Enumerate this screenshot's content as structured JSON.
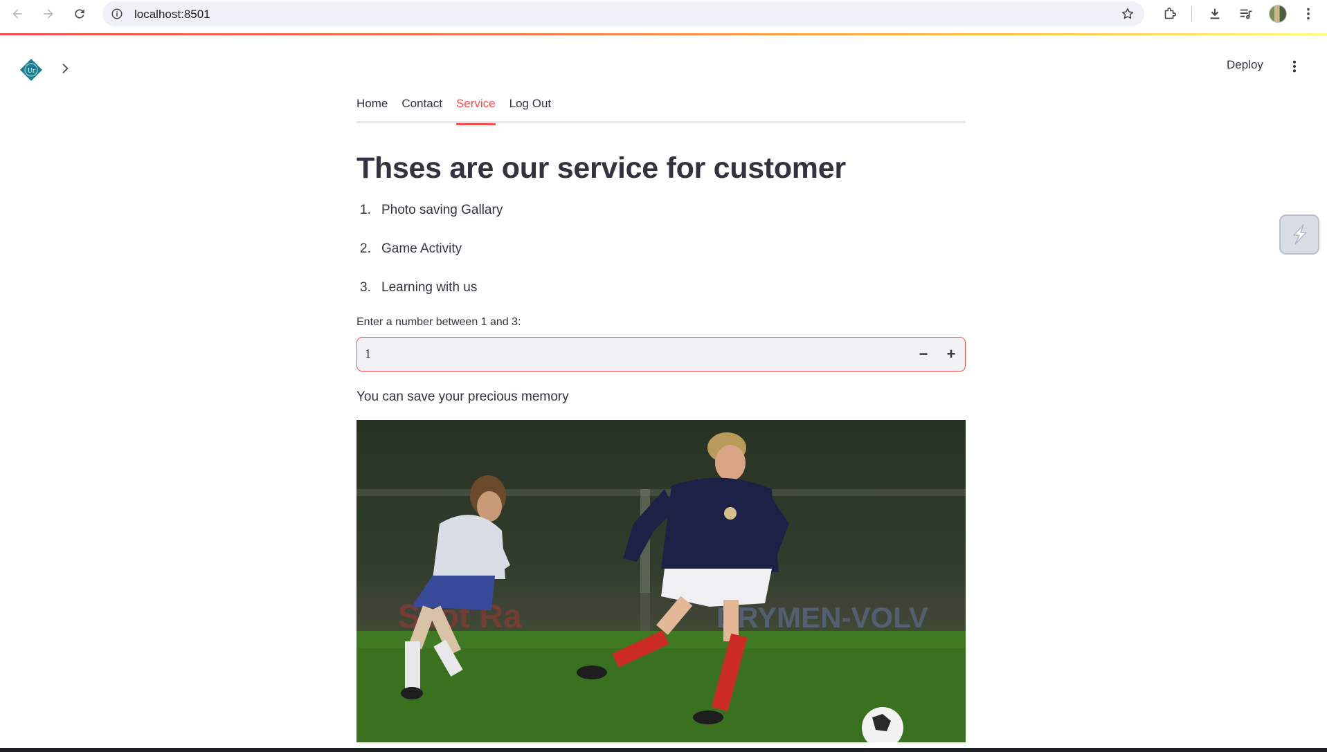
{
  "browser": {
    "url": "localhost:8501"
  },
  "header": {
    "deploy_label": "Deploy"
  },
  "tabs": [
    {
      "label": "Home",
      "active": false
    },
    {
      "label": "Contact",
      "active": false
    },
    {
      "label": "Service",
      "active": true
    },
    {
      "label": "Log Out",
      "active": false
    }
  ],
  "main": {
    "title": "Thses are our service for customer",
    "services": [
      {
        "num": "1.",
        "label": "Photo saving Gallary"
      },
      {
        "num": "2.",
        "label": "Game Activity"
      },
      {
        "num": "3.",
        "label": "Learning with us"
      }
    ],
    "number_input": {
      "label": "Enter a number between 1 and 3:",
      "value": "1",
      "minus": "−",
      "plus": "+"
    },
    "caption": "You can save your precious memory"
  },
  "colors": {
    "accent": "#ff4b4b",
    "text": "#31333f",
    "input_bg": "#f0f2f6"
  },
  "icons": [
    "back-arrow-icon",
    "forward-arrow-icon",
    "reload-icon",
    "site-info-icon",
    "star-icon",
    "extensions-icon",
    "download-icon",
    "media-queue-icon",
    "profile-avatar",
    "chrome-menu-icon",
    "app-logo",
    "chevron-right-icon",
    "kebab-menu-icon",
    "streamlit-float-icon"
  ]
}
